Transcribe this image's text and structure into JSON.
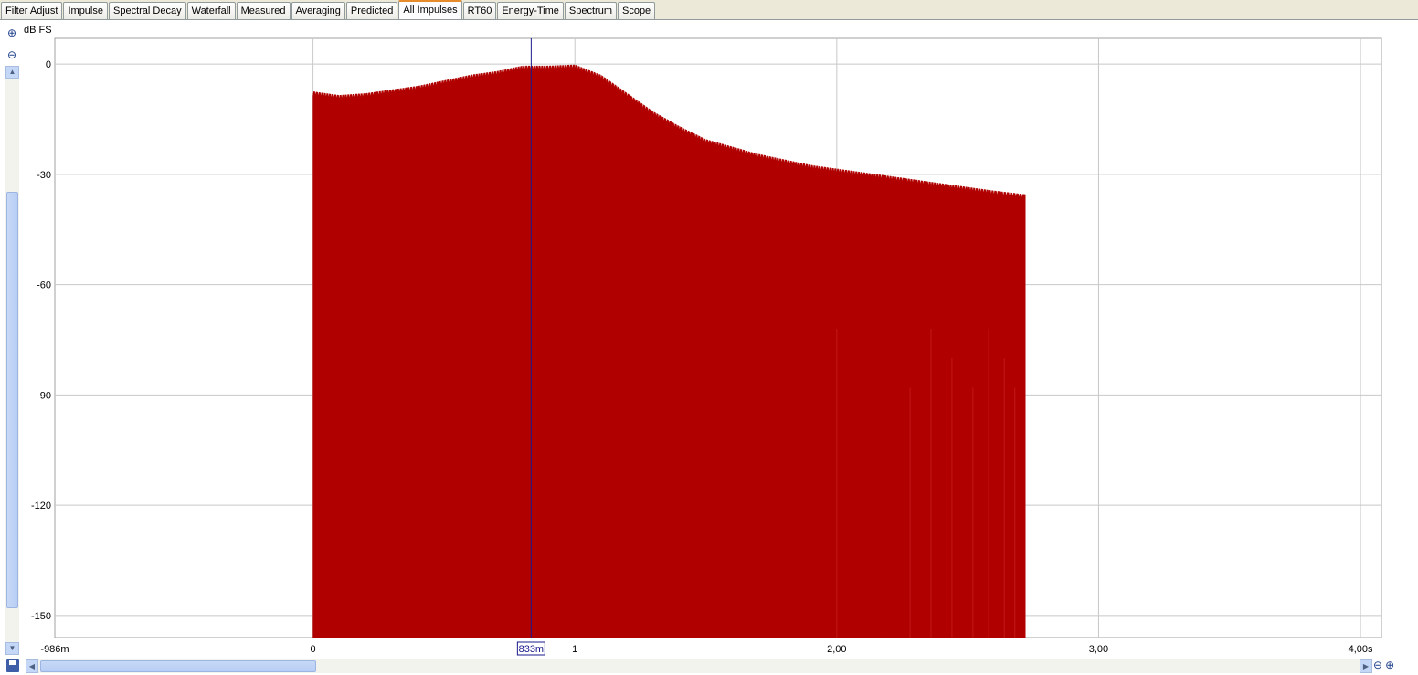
{
  "tabs": [
    {
      "label": "Filter Adjust",
      "active": false
    },
    {
      "label": "Impulse",
      "active": false
    },
    {
      "label": "Spectral Decay",
      "active": false
    },
    {
      "label": "Waterfall",
      "active": false
    },
    {
      "label": "Measured",
      "active": false
    },
    {
      "label": "Averaging",
      "active": false
    },
    {
      "label": "Predicted",
      "active": false
    },
    {
      "label": "All Impulses",
      "active": true
    },
    {
      "label": "RT60",
      "active": false
    },
    {
      "label": "Energy-Time",
      "active": false
    },
    {
      "label": "Spectrum",
      "active": false
    },
    {
      "label": "Scope",
      "active": false
    }
  ],
  "toolbar": {
    "zoom_in_icon": "zoom-in-icon",
    "zoom_out_icon": "zoom-out-icon",
    "save_icon": "save-icon"
  },
  "chart_data": {
    "type": "area",
    "title": "",
    "ylabel": "dB FS",
    "xlabel": "",
    "xlim": [
      -0.986,
      4.08
    ],
    "ylim": [
      -156,
      7
    ],
    "x_ticks": [
      {
        "value": -0.986,
        "label": "-986m"
      },
      {
        "value": 0,
        "label": "0"
      },
      {
        "value": 1,
        "label": "1"
      },
      {
        "value": 2,
        "label": "2,00"
      },
      {
        "value": 3,
        "label": "3,00"
      },
      {
        "value": 4,
        "label": "4,00s"
      }
    ],
    "y_ticks": [
      {
        "value": 0,
        "label": "0"
      },
      {
        "value": -30,
        "label": "-30"
      },
      {
        "value": -60,
        "label": "-60"
      },
      {
        "value": -90,
        "label": "-90"
      },
      {
        "value": -120,
        "label": "-120"
      },
      {
        "value": -150,
        "label": "-150"
      }
    ],
    "grid": true,
    "fill_color": "#b00000",
    "cursor": {
      "x": 0.833,
      "label": "833m",
      "color": "#1a1a8c"
    },
    "series": [
      {
        "x": [
          0,
          0.1,
          0.2,
          0.3,
          0.4,
          0.5,
          0.6,
          0.7,
          0.8,
          0.9,
          1.0,
          1.1,
          1.2,
          1.3,
          1.4,
          1.5,
          1.6,
          1.7,
          1.8,
          1.9,
          2.0,
          2.1,
          2.2,
          2.3,
          2.4,
          2.5,
          2.6,
          2.72
        ],
        "values": [
          -7.5,
          -8.5,
          -8,
          -7,
          -6,
          -4.5,
          -3,
          -2,
          -0.5,
          -0.5,
          -0.2,
          -3,
          -8,
          -13,
          -17,
          -20.5,
          -22.5,
          -24.5,
          -26,
          -27.5,
          -28.5,
          -29.5,
          -30.5,
          -31.5,
          -32.5,
          -33.5,
          -34.5,
          -35.5
        ]
      }
    ]
  }
}
